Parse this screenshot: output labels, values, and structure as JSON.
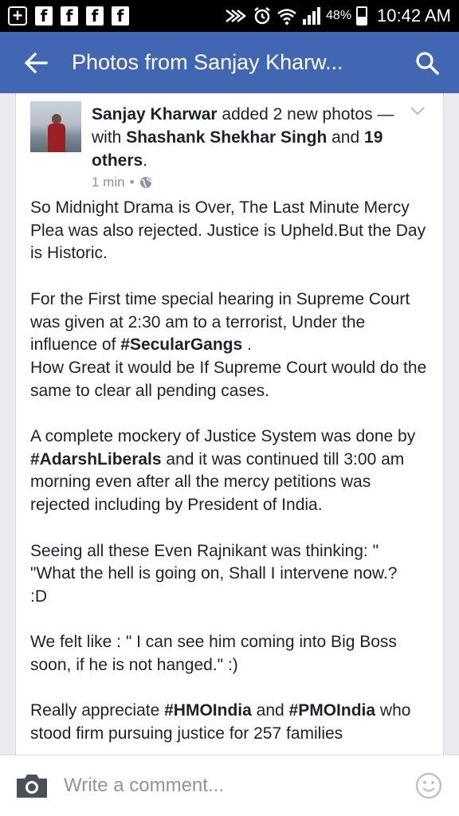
{
  "status_bar": {
    "battery": "48%",
    "time": "10:42 AM",
    "notification_icons": [
      "add-icon",
      "facebook-icon",
      "facebook-icon",
      "facebook-icon",
      "facebook-icon"
    ],
    "system_icons": [
      "nfc-icon",
      "alarm-icon",
      "wifi-icon",
      "signal-icon",
      "battery-icon"
    ]
  },
  "app_bar": {
    "title": "Photos from Sanjay Kharw...",
    "back_icon": "arrow-left-icon",
    "search_icon": "search-icon"
  },
  "post": {
    "author": "Sanjay Kharwar",
    "action": "added 2 new photos — with",
    "tagged": "Shashank Shekhar Singh",
    "and": "and",
    "others": "19 others",
    "period": ".",
    "timestamp": "1 min",
    "dot": "•",
    "privacy_icon": "globe-icon",
    "menu_icon": "chevron-down-icon",
    "paragraphs": {
      "p1": "So Midnight Drama is Over, The Last Minute Mercy Plea was also rejected. Justice is Upheld.But the Day is Historic.",
      "p2_a": "For the First time special hearing in Supreme Court was given at 2:30 am to a terrorist, Under the influence of",
      "p2_tag": "#SecularGangs",
      "p2_b": ".",
      "p2_c": "How Great it would be If Supreme Court would do the same to clear all pending cases.",
      "p3_a": "A complete mockery of Justice System was done by",
      "p3_tag": "#AdarshLiberals",
      "p3_b": "and it was continued till 3:00 am morning even after all the mercy petitions was rejected including by President of India.",
      "p4_a": "Seeing all these Even Rajnikant was thinking: \"",
      "p4_b": "\"What the hell is going on, Shall I intervene now.?",
      "p4_c": ":D",
      "p5": "We felt like : \" I can see him coming into Big Boss soon, if he is not hanged.\" :)",
      "p6_a": "Really appreciate",
      "p6_tag1": "#HMOIndia",
      "p6_and": "and",
      "p6_tag2": "#PMOIndia",
      "p6_b": "who stood firm pursuing justice for 257 families"
    }
  },
  "comment_bar": {
    "placeholder": "Write a comment...",
    "camera_icon": "camera-icon",
    "smiley_icon": "smiley-icon"
  }
}
